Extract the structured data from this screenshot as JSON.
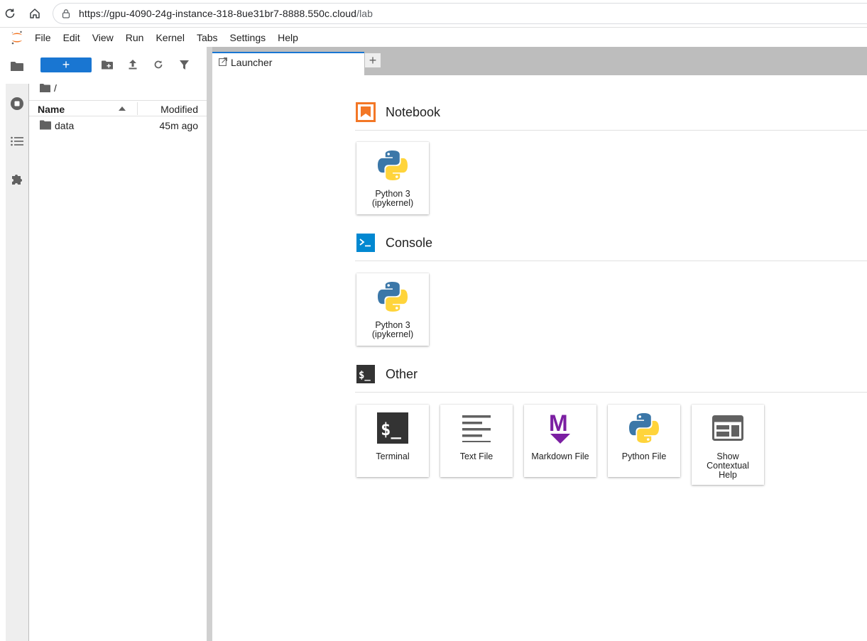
{
  "browser": {
    "url_main": "https://gpu-4090-24g-instance-318-8ue31br7-8888.550c.cloud",
    "url_path": "/lab"
  },
  "menu": {
    "items": [
      "File",
      "Edit",
      "View",
      "Run",
      "Kernel",
      "Tabs",
      "Settings",
      "Help"
    ]
  },
  "filebrowser": {
    "new_button": "+",
    "breadcrumb": "/",
    "columns": {
      "name": "Name",
      "modified": "Modified"
    },
    "rows": [
      {
        "name": "data",
        "modified": "45m ago",
        "type": "folder"
      }
    ]
  },
  "tabs": {
    "active": "Launcher",
    "add": "+"
  },
  "launcher": {
    "sections": [
      {
        "title": "Notebook",
        "icon": "notebook-icon",
        "cards": [
          {
            "label_line1": "Python 3",
            "label_line2": "(ipykernel)",
            "icon": "python-icon"
          }
        ]
      },
      {
        "title": "Console",
        "icon": "console-icon",
        "cards": [
          {
            "label_line1": "Python 3",
            "label_line2": "(ipykernel)",
            "icon": "python-icon"
          }
        ]
      },
      {
        "title": "Other",
        "icon": "terminal-icon",
        "cards": [
          {
            "label_line1": "Terminal",
            "icon": "terminal-icon"
          },
          {
            "label_line1": "Text File",
            "icon": "text-file-icon"
          },
          {
            "label_line1": "Markdown File",
            "icon": "markdown-icon"
          },
          {
            "label_line1": "Python File",
            "icon": "python-icon"
          },
          {
            "label_line1": "Show",
            "label_line2": "Contextual",
            "label_line3": "Help",
            "icon": "contextual-help-icon"
          }
        ]
      }
    ]
  },
  "colors": {
    "accent": "#1976d2",
    "notebook": "#f37726",
    "console": "#0288d1",
    "markdown": "#7b1fa2",
    "python_blue": "#3b77a8",
    "python_yellow": "#ffd43b"
  }
}
